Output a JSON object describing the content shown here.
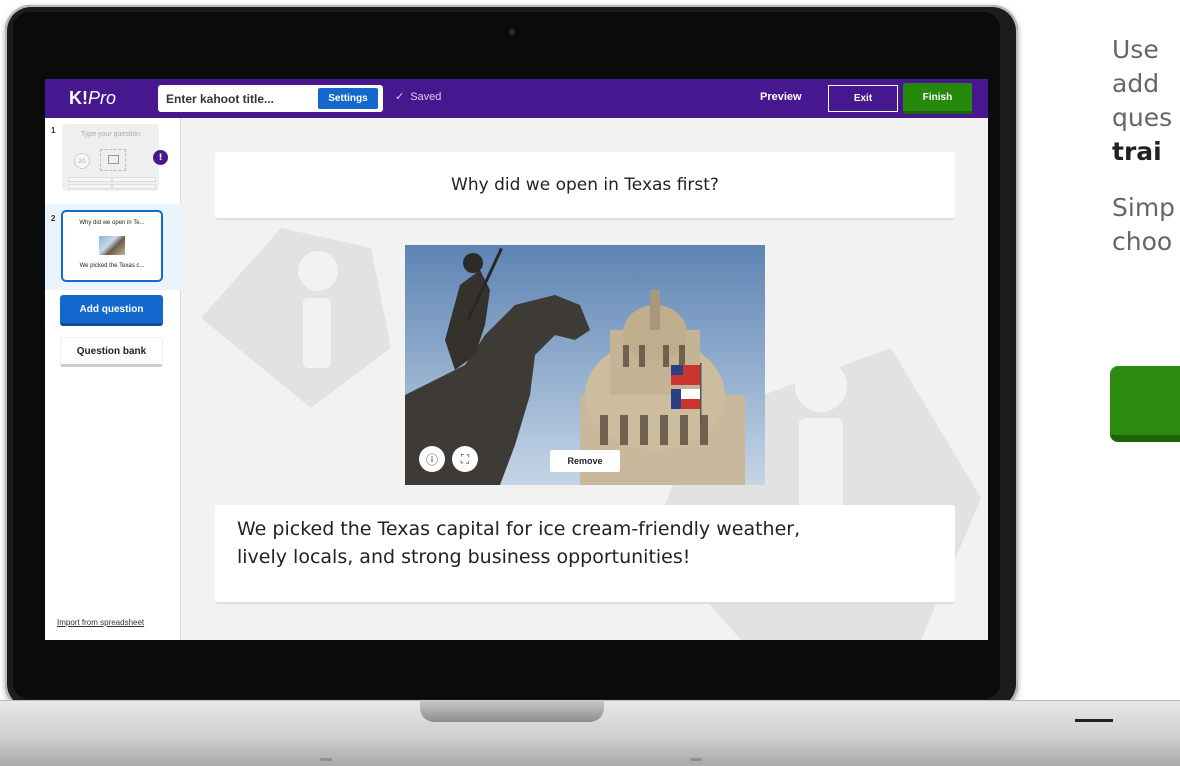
{
  "app": {
    "logo": {
      "bold": "K!",
      "italic": "Pro"
    },
    "title_placeholder": "Enter kahoot title...",
    "settings_label": "Settings",
    "saved_label": "Saved",
    "preview_label": "Preview",
    "exit_label": "Exit",
    "finish_label": "Finish",
    "accent_color": "#46178f",
    "finish_color": "#26890c",
    "primary_button_color": "#1368ce"
  },
  "sidebar": {
    "slides": [
      {
        "number": "1",
        "placeholder": "Type your question",
        "timer": "20",
        "status": "!"
      },
      {
        "number": "2",
        "question": "Why did we open in Te...",
        "answer": "We picked the Texas c..."
      }
    ],
    "add_question_label": "Add question",
    "question_bank_label": "Question bank",
    "import_label": "Import from spreadsheet"
  },
  "editor": {
    "question": "Why did we open in Texas first?",
    "media": {
      "remove_label": "Remove",
      "info_icon": "info-icon",
      "crop_icon": "crop-icon"
    },
    "answer_line1": "We picked the Texas capital for ice cream-friendly weather,",
    "answer_line2": "lively locals, and strong business opportunities!"
  },
  "side_copy": {
    "line1": "Use",
    "line2": "add",
    "line3": "ques",
    "line4": "trai",
    "line5": "Simp",
    "line6": "choo"
  }
}
